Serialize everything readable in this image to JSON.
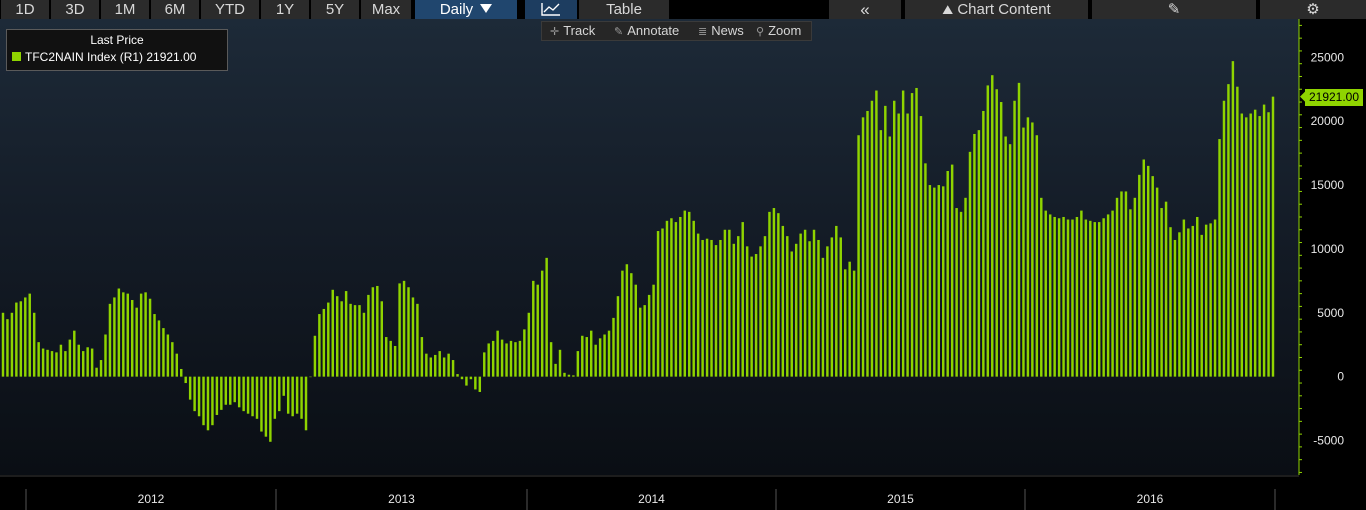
{
  "toolbar": {
    "ranges": [
      {
        "label": "1D"
      },
      {
        "label": "3D"
      },
      {
        "label": "1M"
      },
      {
        "label": "6M"
      },
      {
        "label": "YTD"
      },
      {
        "label": "1Y"
      },
      {
        "label": "5Y"
      },
      {
        "label": "Max"
      }
    ],
    "frequency": "Daily",
    "table_label": "Table",
    "chart_content_label": "Chart Content"
  },
  "subtoolbar": {
    "track": "Track",
    "annotate": "Annotate",
    "news": "News",
    "zoom": "Zoom"
  },
  "legend": {
    "title": "Last Price",
    "series_text": "TFC2NAIN Index  (R1) 21921.00"
  },
  "price_label": "21921.00",
  "colors": {
    "bar": "#8fd400",
    "active_button": "#20466e",
    "background": "#000000"
  },
  "chart_data": {
    "type": "bar",
    "series": [
      {
        "name": "TFC2NAIN Index",
        "values": [
          5000,
          4500,
          5000,
          5800,
          5900,
          6200,
          6500,
          5000,
          2700,
          2200,
          2100,
          2000,
          1900,
          2500,
          2000,
          2900,
          3600,
          2500,
          2000,
          2300,
          2200,
          700,
          1300,
          3300,
          5700,
          6200,
          6900,
          6600,
          6500,
          6000,
          5400,
          6500,
          6600,
          6100,
          4900,
          4400,
          3800,
          3300,
          2700,
          1800,
          600,
          -500,
          -1800,
          -2700,
          -3100,
          -3800,
          -4200,
          -3800,
          -3000,
          -2600,
          -2200,
          -2200,
          -2000,
          -2400,
          -2700,
          -2900,
          -3100,
          -3300,
          -4300,
          -4700,
          -5100,
          -3300,
          -2700,
          -1500,
          -2900,
          -3100,
          -2900,
          -3300,
          -4200,
          0,
          3200,
          4900,
          5300,
          5800,
          6800,
          6300,
          5900,
          6700,
          5700,
          5600,
          5600,
          5000,
          6400,
          7000,
          7100,
          5900,
          3100,
          2800,
          2400,
          7300,
          7500,
          7000,
          6200,
          5700,
          3100,
          1800,
          1500,
          1700,
          2000,
          1500,
          1800,
          1300,
          200,
          -200,
          -700,
          -200,
          -1000,
          -1200,
          1900,
          2600,
          2800,
          3600,
          2900,
          2600,
          2800,
          2700,
          2800,
          3700,
          5000,
          7500,
          7200,
          8300,
          9300,
          2700,
          1000,
          2100,
          300,
          150,
          100,
          2000,
          3200,
          3100,
          3600,
          2500,
          3000,
          3300,
          3600,
          4600,
          6300,
          8300,
          8800,
          8100,
          7200,
          5400,
          5600,
          6400,
          7200,
          11400,
          11600,
          12200,
          12400,
          12100,
          12500,
          13000,
          12900,
          12200,
          11200,
          10700,
          10800,
          10700,
          10300,
          10700,
          11500,
          11500,
          10400,
          11000,
          12100,
          10200,
          9400,
          9600,
          10200,
          11000,
          12900,
          13200,
          12800,
          11800,
          11000,
          9800,
          10400,
          11200,
          11500,
          10600,
          11500,
          10700,
          9300,
          10200,
          10900,
          11800,
          10900,
          8400,
          9000,
          8300,
          18900,
          20300,
          20800,
          21600,
          22400,
          19300,
          21200,
          18800,
          21600,
          20600,
          22400,
          20600,
          22200,
          22600,
          20400,
          16700,
          15000,
          14800,
          15000,
          14900,
          16100,
          16600,
          13200,
          12900,
          14000,
          17600,
          19000,
          19300,
          20800,
          22800,
          23600,
          22500,
          21500,
          18800,
          18200,
          21600,
          23000,
          19500,
          20300,
          19900,
          18900,
          14000,
          13000,
          12700,
          12500,
          12400,
          12500,
          12300,
          12300,
          12500,
          13000,
          12300,
          12200,
          12100,
          12100,
          12400,
          12700,
          13000,
          14000,
          14500,
          14500,
          13100,
          14000,
          15800,
          17000,
          16500,
          15700,
          14800,
          13200,
          13700,
          11700,
          10700,
          11300,
          12300,
          11600,
          11800,
          12500,
          11100,
          11900,
          12000,
          12300,
          18600,
          21600,
          22900,
          24700,
          22700,
          20600,
          20300,
          20600,
          20900,
          20400,
          21300,
          20700,
          21921
        ]
      }
    ],
    "x_labels": [
      "2012",
      "2013",
      "2014",
      "2015",
      "2016"
    ],
    "y_ticks": [
      -5000,
      0,
      5000,
      10000,
      15000,
      20000,
      25000
    ],
    "ylim": [
      -7700,
      28000
    ],
    "last_value": 21921
  }
}
